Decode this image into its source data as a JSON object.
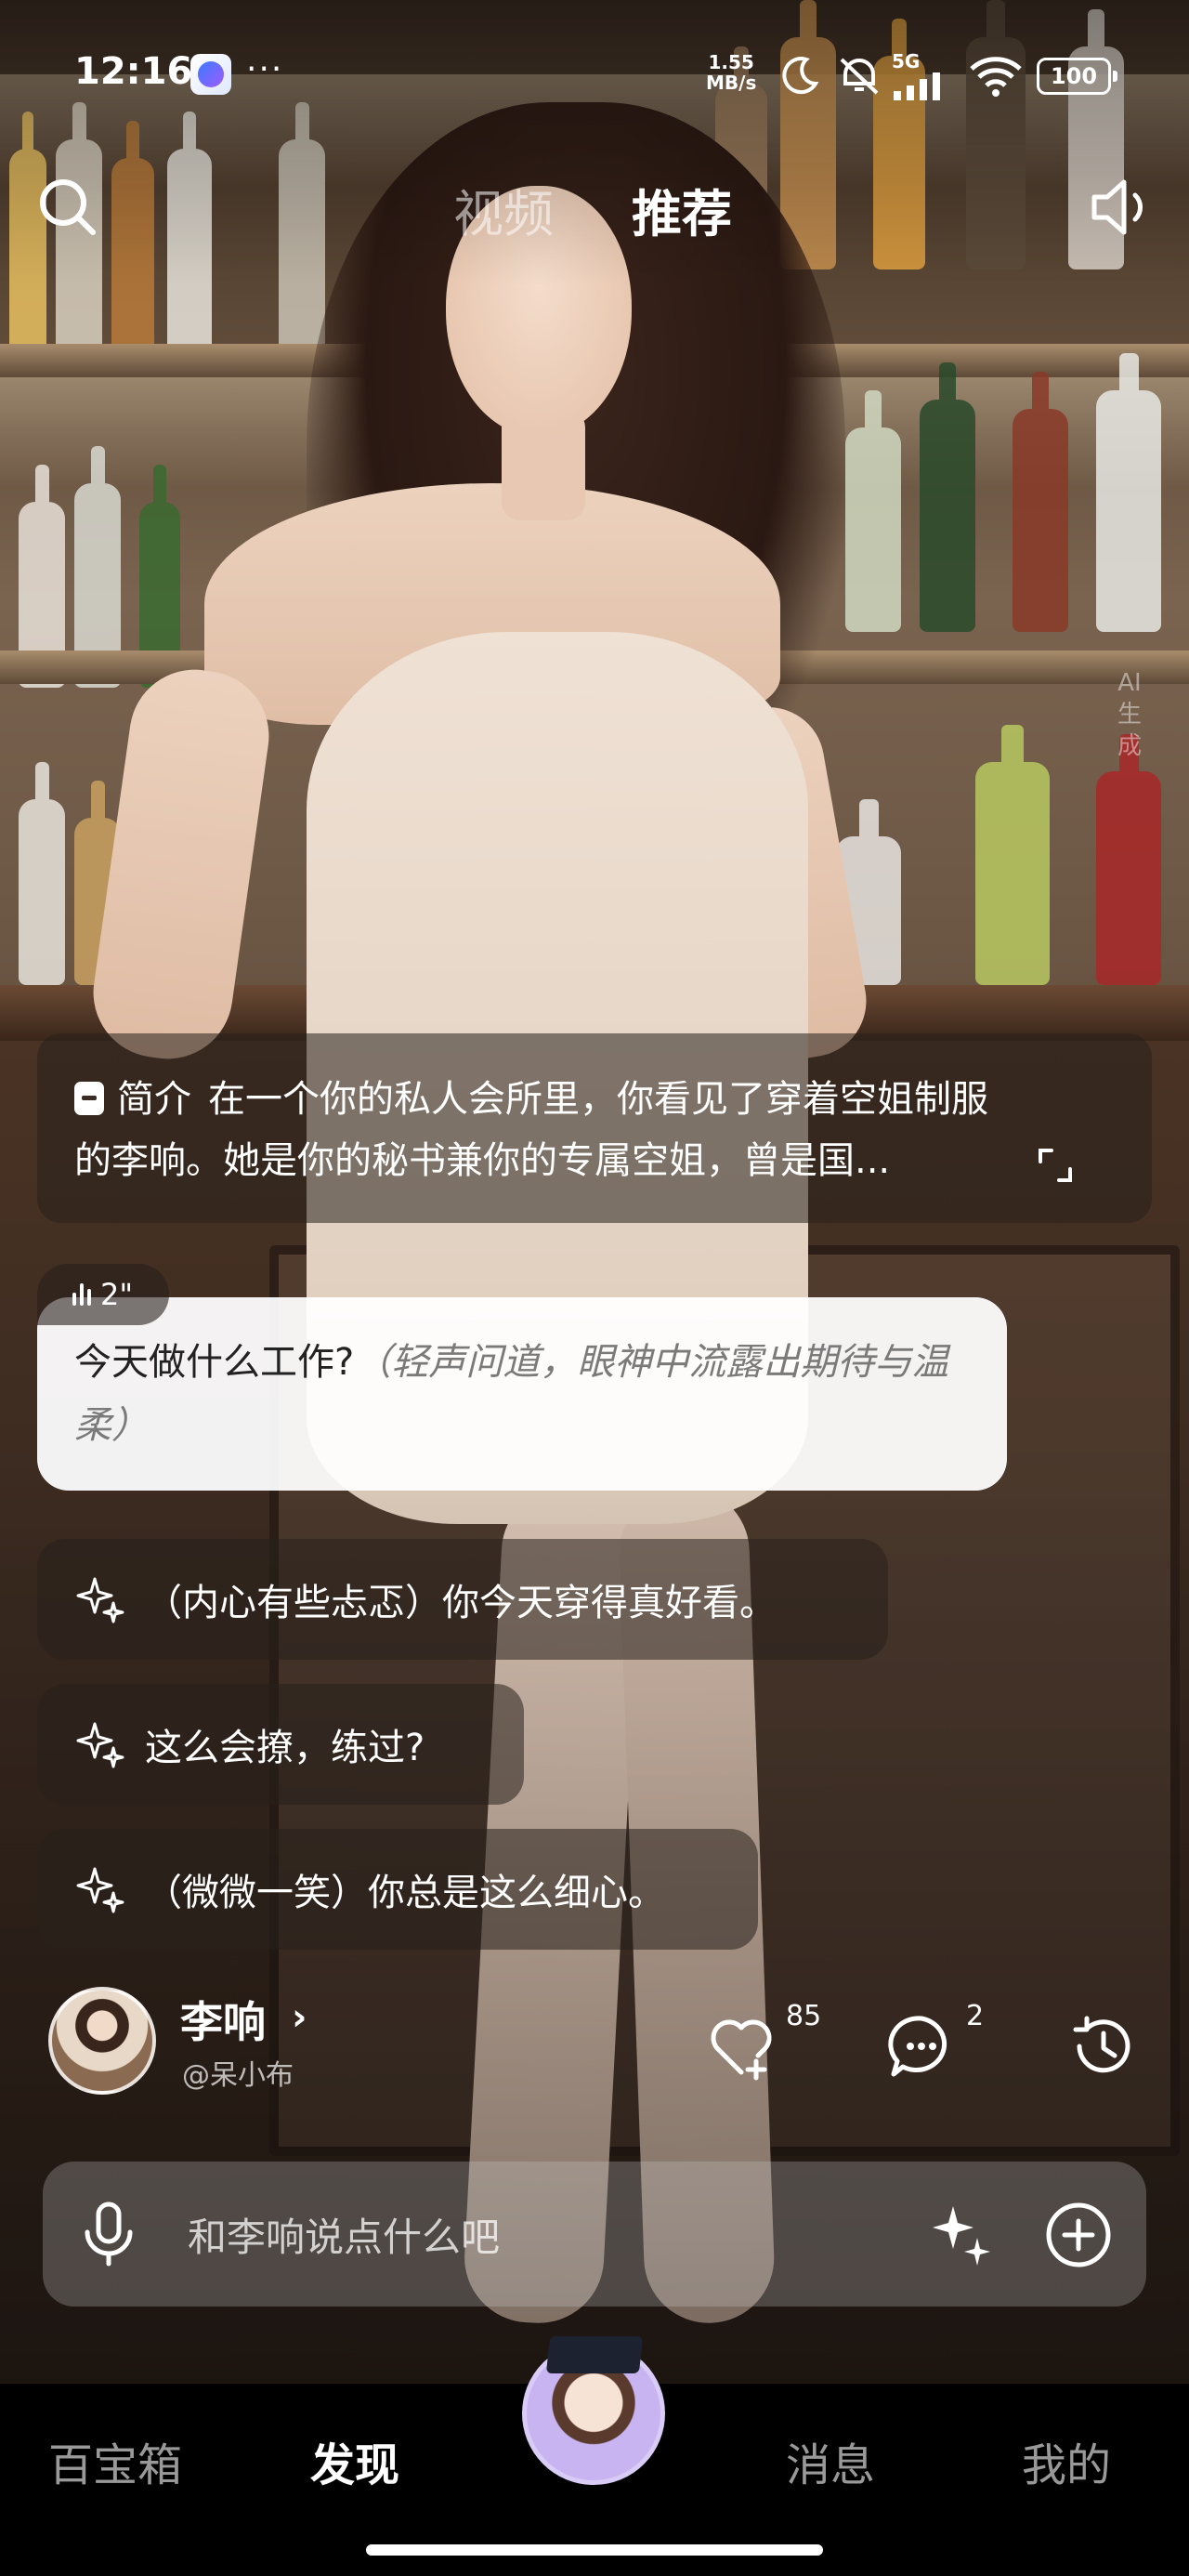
{
  "status_bar": {
    "time": "12:16",
    "more": "···",
    "net_speed_value": "1.55",
    "net_speed_unit": "MB/s",
    "network": "5G",
    "battery": "100"
  },
  "top_nav": {
    "tabs": [
      "视频",
      "推荐"
    ],
    "active_tab": "推荐"
  },
  "ai_badge": "AI生成",
  "intro": {
    "label": "简介",
    "text": "在一个你的私人会所里，你看见了穿着空姐制服的李响。她是你的秘书兼你的专属空姐，曾是国..."
  },
  "message": {
    "voice_duration": "2\"",
    "text": "今天做什么工作?",
    "action": "（轻声问道，眼神中流露出期待与温柔）"
  },
  "suggestions": [
    "（内心有些忐忑）你今天穿得真好看。",
    "这么会撩，练过?",
    "（微微一笑）你总是这么细心。"
  ],
  "character": {
    "name": "李响",
    "chevron": "›",
    "handle": "@呆小布"
  },
  "actions": {
    "likes": "85",
    "comments": "2"
  },
  "input": {
    "placeholder": "和李响说点什么吧"
  },
  "bottom_tabs": {
    "tab1": "百宝箱",
    "tab2": "发现",
    "tab3": "消息",
    "tab4": "我的",
    "active": "发现"
  }
}
